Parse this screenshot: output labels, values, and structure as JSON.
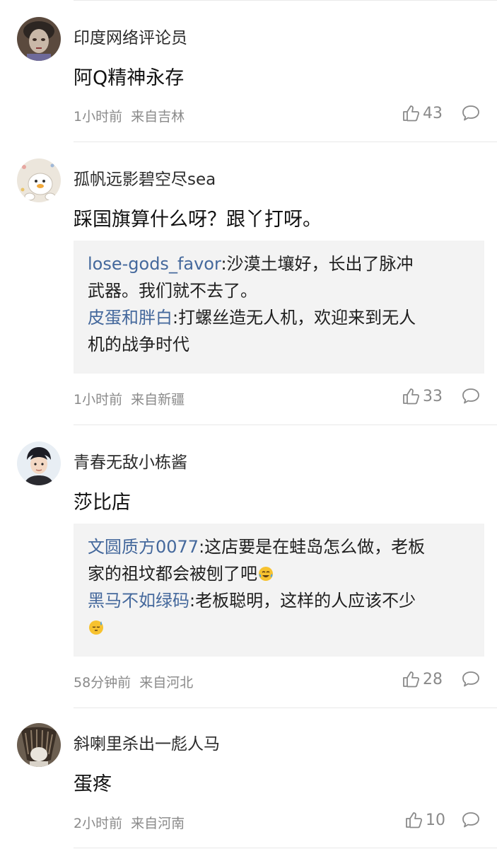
{
  "comments": [
    {
      "username": "印度网络评论员",
      "text": "阿Q精神永存",
      "time": "1小时前",
      "location": "来自吉林",
      "likes": "43",
      "replies": []
    },
    {
      "username": "孤帆远影碧空尽sea",
      "text": "踩国旗算什么呀？跟丫打呀。",
      "time": "1小时前",
      "location": "来自新疆",
      "likes": "33",
      "replies": [
        {
          "user": "lose-gods_favor",
          "text": ":沙漠土壤好，长出了脉冲",
          "text2": "武器。我们就不去了。"
        },
        {
          "user": "皮蛋和胖白",
          "text": ":打螺丝造无人机，欢迎来到无人",
          "text2": "机的战争时代"
        }
      ]
    },
    {
      "username": "青春无敌小栋酱",
      "text": "莎比店",
      "time": "58分钟前",
      "location": "来自河北",
      "likes": "28",
      "replies": [
        {
          "user": "文圆质方0077",
          "text": ":这店要是在蛙岛怎么做，老板",
          "text2": "家的祖坟都会被刨了吧",
          "emoji2": "laughing-tears-emoji"
        },
        {
          "user": "黑马不如绿码",
          "text": ":老板聪明，这样的人应该不少",
          "text2": "",
          "emoji2": "sweat-emoji"
        }
      ]
    },
    {
      "username": "斜喇里杀出一彪人马",
      "text": "蛋疼",
      "time": "2小时前",
      "location": "来自河南",
      "likes": "10",
      "replies": []
    }
  ],
  "icons": {
    "like": "thumbs-up-icon",
    "reply": "comment-bubble-icon"
  },
  "colors": {
    "reply_user": "#44689c",
    "meta": "#8a8a8a",
    "reply_box": "#f3f3f3"
  }
}
